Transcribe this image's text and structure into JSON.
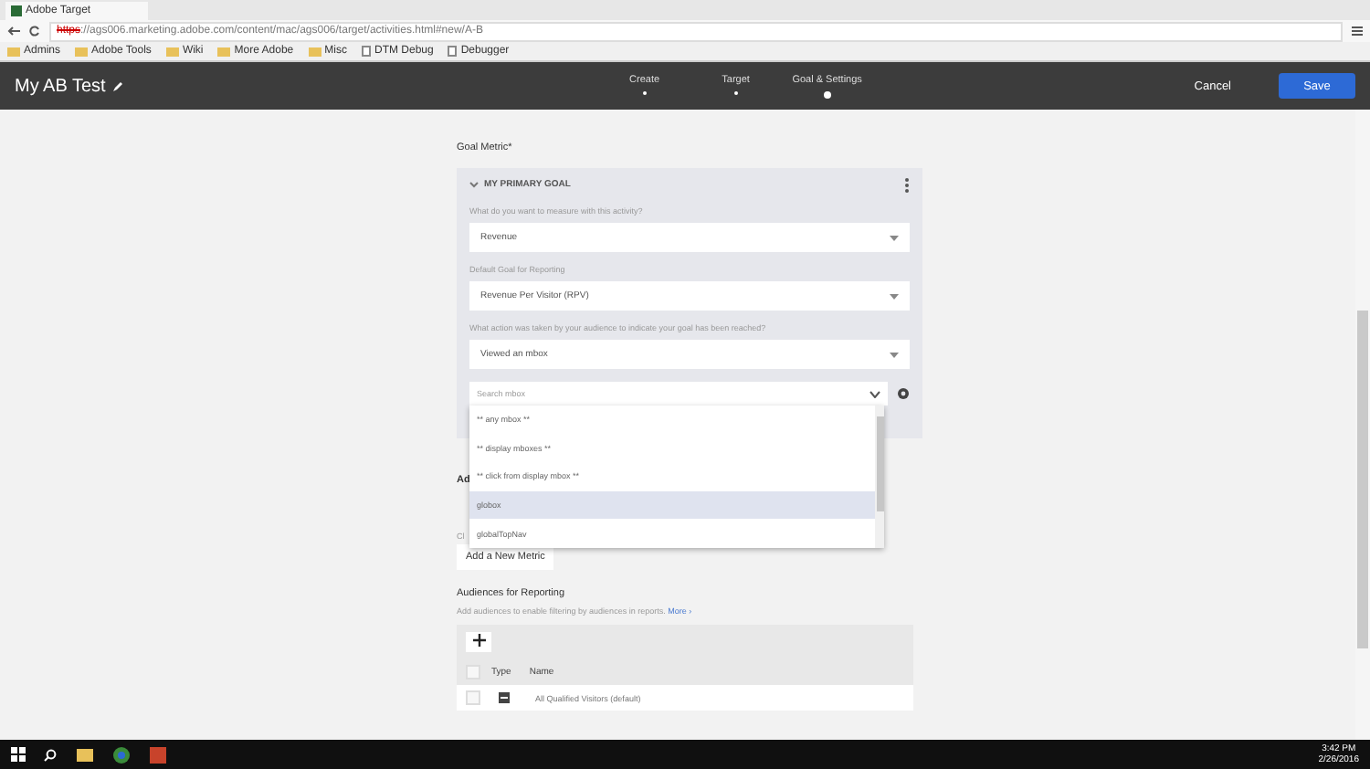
{
  "browser": {
    "tab_title": "Adobe Target",
    "url_scheme": "https",
    "url_rest": "://ags006.marketing.adobe.com/content/mac/ags006/target/activities.html#new/A-B",
    "bookmarks": [
      {
        "label": "Admins",
        "kind": "folder"
      },
      {
        "label": "Adobe Tools",
        "kind": "folder"
      },
      {
        "label": "Wiki",
        "kind": "folder"
      },
      {
        "label": "More Adobe",
        "kind": "folder"
      },
      {
        "label": "Misc",
        "kind": "folder"
      },
      {
        "label": "DTM Debug",
        "kind": "page"
      },
      {
        "label": "Debugger",
        "kind": "page"
      }
    ]
  },
  "header": {
    "title": "My AB Test",
    "steps": [
      {
        "label": "Create",
        "selected": false
      },
      {
        "label": "Target",
        "selected": false
      },
      {
        "label": "Goal & Settings",
        "selected": true
      }
    ],
    "cancel": "Cancel",
    "save": "Save"
  },
  "goal": {
    "label": "Goal Metric*",
    "card_title": "MY PRIMARY GOAL",
    "fields": [
      {
        "label": "What do you want to measure with this activity?",
        "value": "Revenue"
      },
      {
        "label": "Default Goal for Reporting",
        "value": "Revenue Per Visitor (RPV)"
      },
      {
        "label": "What action was taken by your audience to indicate your goal has been reached?",
        "value": "Viewed an mbox"
      }
    ],
    "search": {
      "placeholder": "Search mbox"
    },
    "options": [
      {
        "label": "** any mbox **",
        "selected": false
      },
      {
        "label": "** display mboxes **",
        "selected": false
      },
      {
        "label": "** click from display mbox **",
        "selected": false
      },
      {
        "label": "globox",
        "selected": true
      },
      {
        "label": "globalTopNav",
        "selected": false
      }
    ],
    "hidden_label": "Ad",
    "hidden_hint": "Cl",
    "add_metric": "Add a New Metric"
  },
  "audiences": {
    "title": "Audiences for Reporting",
    "hint": "Add audiences to enable filtering by audiences in reports.",
    "more": "More ›",
    "all_checked": false,
    "columns": [
      "Type",
      "Name"
    ],
    "rows": [
      {
        "name": "All Qualified Visitors (default)",
        "checked": false
      }
    ]
  },
  "taskbar": {
    "time": "3:42 PM",
    "date": "2/26/2016"
  }
}
